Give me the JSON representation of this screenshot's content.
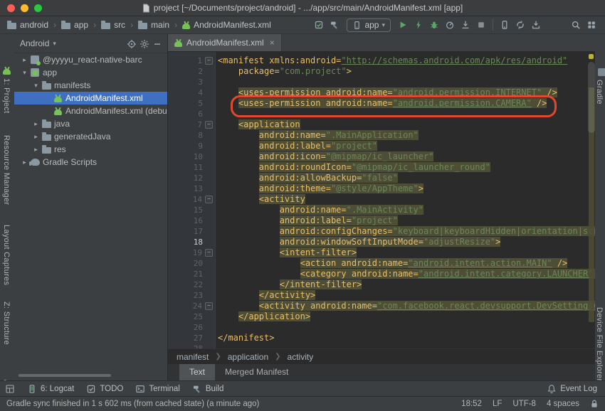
{
  "window": {
    "title": "project [~/Documents/project/android] - .../app/src/main/AndroidManifest.xml [app]"
  },
  "navbar": {
    "breadcrumbs": [
      "android",
      "app",
      "src",
      "main",
      "AndroidManifest.xml"
    ],
    "run_config": "app",
    "icon_groups": [
      [
        "sync-status-icon",
        "make-project-icon"
      ],
      [
        "run-icon",
        "apply-changes-icon",
        "debug-icon",
        "profiler-icon",
        "attach-debugger-icon",
        "stop-icon"
      ],
      [
        "device-manager-icon",
        "gradle-sync-icon",
        "sdk-manager-icon"
      ],
      [
        "search-icon",
        "project-structure-icon"
      ]
    ]
  },
  "left_stripe": {
    "items": [
      {
        "label": "1: Project",
        "icon": "android"
      },
      {
        "label": "Resource Manager"
      },
      {
        "label": "Layout Captures"
      },
      {
        "label": "Z: Structure"
      },
      {
        "label": "Favorites",
        "clipped": true
      }
    ]
  },
  "right_stripe": {
    "items": [
      {
        "label": "Gradle",
        "icon": "gray"
      },
      {
        "label": "Device File Explorer"
      }
    ]
  },
  "project_panel": {
    "view": "Android",
    "tree": [
      {
        "label": "@yyyyu_react-native-barc",
        "icon": "module",
        "indent": 0,
        "arrow": "right"
      },
      {
        "label": "app",
        "icon": "app",
        "indent": 0,
        "arrow": "down"
      },
      {
        "label": "manifests",
        "icon": "folder",
        "indent": 1,
        "arrow": "down"
      },
      {
        "label": "AndroidManifest.xml",
        "icon": "android-file",
        "indent": 2,
        "arrow": "none",
        "selected": true
      },
      {
        "label": "AndroidManifest.xml (debug)",
        "icon": "android-file",
        "indent": 2,
        "arrow": "none"
      },
      {
        "label": "java",
        "icon": "folder",
        "indent": 1,
        "arrow": "right"
      },
      {
        "label": "generatedJava",
        "icon": "folder",
        "indent": 1,
        "arrow": "right"
      },
      {
        "label": "res",
        "icon": "folder",
        "indent": 1,
        "arrow": "right"
      },
      {
        "label": "Gradle Scripts",
        "icon": "gradle",
        "indent": 0,
        "arrow": "right"
      }
    ]
  },
  "editor": {
    "tab": "AndroidManifest.xml",
    "xml_breadcrumb": [
      "manifest",
      "application",
      "activity"
    ],
    "bottom_tabs": [
      {
        "label": "Text",
        "selected": true
      },
      {
        "label": "Merged Manifest",
        "selected": false
      }
    ],
    "code": {
      "lines": [
        {
          "n": 1,
          "fold": true,
          "tokens": [
            [
              "t",
              "<manifest xmlns:android="
            ],
            [
              "su",
              "\"http://schemas.android.com/apk/res/android\""
            ]
          ]
        },
        {
          "n": 2,
          "tokens": [
            [
              "p",
              "    "
            ],
            [
              "t",
              "package="
            ],
            [
              "s",
              "\"com.project\""
            ],
            [
              "t",
              ">"
            ]
          ]
        },
        {
          "n": 3,
          "tokens": []
        },
        {
          "n": 4,
          "marked": true,
          "tokens": [
            [
              "p",
              "    "
            ],
            [
              "t",
              "<uses-permission android:name="
            ],
            [
              "su",
              "\"android.permission.INTERNET\""
            ],
            [
              "t",
              " />"
            ]
          ]
        },
        {
          "n": 5,
          "marked": true,
          "annotated": true,
          "tokens": [
            [
              "p",
              "    "
            ],
            [
              "t",
              "<uses-permission android:name="
            ],
            [
              "su",
              "\"android.permission.CAMERA\""
            ],
            [
              "t",
              " />"
            ]
          ]
        },
        {
          "n": 6,
          "tokens": []
        },
        {
          "n": 7,
          "marked": true,
          "fold": true,
          "tokens": [
            [
              "p",
              "    "
            ],
            [
              "t",
              "<application"
            ]
          ]
        },
        {
          "n": 8,
          "marked": true,
          "tokens": [
            [
              "p",
              "        "
            ],
            [
              "t",
              "android:name="
            ],
            [
              "s",
              "\".MainApplication\""
            ]
          ]
        },
        {
          "n": 9,
          "marked": true,
          "tokens": [
            [
              "p",
              "        "
            ],
            [
              "t",
              "android:label="
            ],
            [
              "s",
              "\"project\""
            ]
          ]
        },
        {
          "n": 10,
          "marked": true,
          "tokens": [
            [
              "p",
              "        "
            ],
            [
              "t",
              "android:icon="
            ],
            [
              "s",
              "\"@mipmap/ic_launcher\""
            ]
          ]
        },
        {
          "n": 11,
          "marked": true,
          "tokens": [
            [
              "p",
              "        "
            ],
            [
              "t",
              "android:roundIcon="
            ],
            [
              "s",
              "\"@mipmap/ic_launcher_round\""
            ]
          ]
        },
        {
          "n": 12,
          "marked": true,
          "tokens": [
            [
              "p",
              "        "
            ],
            [
              "t",
              "android:allowBackup="
            ],
            [
              "s",
              "\"false\""
            ]
          ]
        },
        {
          "n": 13,
          "marked": true,
          "tokens": [
            [
              "p",
              "        "
            ],
            [
              "t",
              "android:theme="
            ],
            [
              "s",
              "\"@style/AppTheme\""
            ],
            [
              "t",
              ">"
            ]
          ]
        },
        {
          "n": 14,
          "marked": true,
          "fold": true,
          "tokens": [
            [
              "p",
              "        "
            ],
            [
              "t",
              "<activity"
            ]
          ]
        },
        {
          "n": 15,
          "marked": true,
          "tokens": [
            [
              "p",
              "            "
            ],
            [
              "t",
              "android:name="
            ],
            [
              "s",
              "\".MainActivity\""
            ]
          ]
        },
        {
          "n": 16,
          "marked": true,
          "tokens": [
            [
              "p",
              "            "
            ],
            [
              "t",
              "android:label="
            ],
            [
              "s",
              "\"project\""
            ]
          ]
        },
        {
          "n": 17,
          "marked": true,
          "tokens": [
            [
              "p",
              "            "
            ],
            [
              "t",
              "android:configChanges="
            ],
            [
              "s",
              "\"keyboard|keyboardHidden|orientation|screenSize\""
            ]
          ]
        },
        {
          "n": 18,
          "marked": true,
          "current": true,
          "tokens": [
            [
              "p",
              "            "
            ],
            [
              "t",
              "android:windowSoftInputMode="
            ],
            [
              "s",
              "\"adjustResize\""
            ],
            [
              "t",
              ">"
            ]
          ]
        },
        {
          "n": 19,
          "marked": true,
          "fold": true,
          "tokens": [
            [
              "p",
              "            "
            ],
            [
              "t",
              "<intent-filter>"
            ]
          ]
        },
        {
          "n": 20,
          "marked": true,
          "tokens": [
            [
              "p",
              "                "
            ],
            [
              "t",
              "<action android:name="
            ],
            [
              "su",
              "\"android.intent.action.MAIN\""
            ],
            [
              "t",
              " />"
            ]
          ]
        },
        {
          "n": 21,
          "marked": true,
          "tokens": [
            [
              "p",
              "                "
            ],
            [
              "t",
              "<category android:name="
            ],
            [
              "su",
              "\"android.intent.category.LAUNCHER\""
            ],
            [
              "t",
              " />"
            ]
          ]
        },
        {
          "n": 22,
          "marked": true,
          "tokens": [
            [
              "p",
              "            "
            ],
            [
              "t",
              "</intent-filter>"
            ]
          ]
        },
        {
          "n": 23,
          "marked": true,
          "tokens": [
            [
              "p",
              "        "
            ],
            [
              "t",
              "</activity>"
            ]
          ]
        },
        {
          "n": 24,
          "marked": true,
          "fold": true,
          "tokens": [
            [
              "p",
              "        "
            ],
            [
              "t",
              "<activity android:name="
            ],
            [
              "su",
              "\"com.facebook.react.devsupport.DevSettingsActivity\""
            ],
            [
              "t",
              " />"
            ]
          ]
        },
        {
          "n": 25,
          "marked": true,
          "tokens": [
            [
              "p",
              "    "
            ],
            [
              "t",
              "</application>"
            ]
          ]
        },
        {
          "n": 26,
          "tokens": []
        },
        {
          "n": 27,
          "tokens": [
            [
              "t",
              "</manifest>"
            ]
          ]
        },
        {
          "n": 28,
          "tokens": []
        }
      ]
    }
  },
  "bottom_bar": {
    "items": [
      {
        "label": "6: Logcat",
        "icon": "logcat-icon"
      },
      {
        "label": "TODO",
        "icon": "todo-icon"
      },
      {
        "label": "Terminal",
        "icon": "terminal-icon"
      },
      {
        "label": "Build",
        "icon": "build-icon"
      }
    ],
    "right_item": {
      "label": "Event Log",
      "icon": "event-log-icon"
    }
  },
  "status_bar": {
    "message": "Gradle sync finished in 1 s 602 ms (from cached state) (a minute ago)",
    "right_items": [
      "18:52",
      "LF",
      "UTF-8",
      "4 spaces"
    ]
  },
  "colors": {
    "selection": "#3E6FC1",
    "annotation_red": "#E2482E",
    "tag_yellow": "#E8BF6A",
    "string_green": "#6A8759",
    "highlight_olive": "#4E4D36"
  }
}
